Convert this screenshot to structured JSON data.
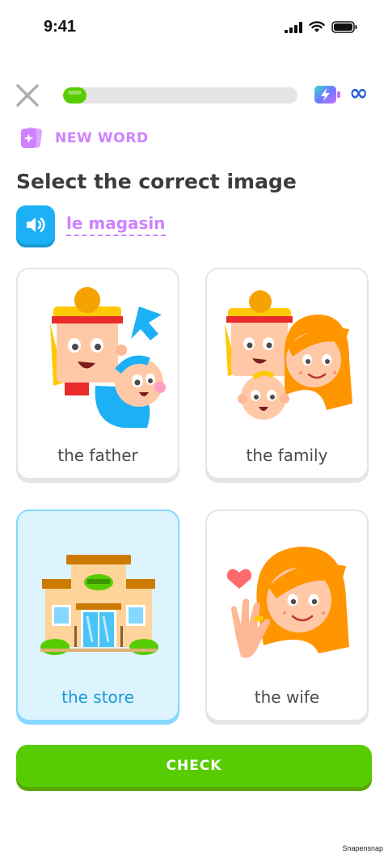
{
  "status_bar": {
    "time": "9:41"
  },
  "header": {
    "progress": 0.1,
    "energy": "∞"
  },
  "badge": {
    "label": "NEW WORD"
  },
  "prompt": {
    "title": "Select the correct image",
    "word": "le magasin"
  },
  "options": [
    {
      "label": "the father",
      "selected": false
    },
    {
      "label": "the family",
      "selected": false
    },
    {
      "label": "the store",
      "selected": true
    },
    {
      "label": "the wife",
      "selected": false
    }
  ],
  "check_button": {
    "label": "CHECK"
  },
  "watermark": "Snapensnap",
  "colors": {
    "primary_green": "#58cc02",
    "accent_blue": "#1cb0f6",
    "accent_purple": "#ce82ff",
    "selected_bg": "#ddf4ff"
  }
}
